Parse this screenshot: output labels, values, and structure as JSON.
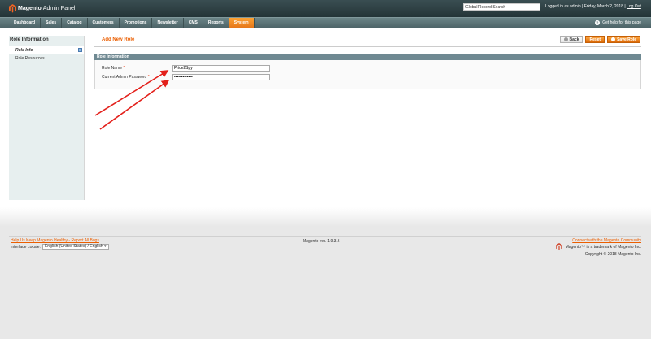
{
  "header": {
    "brand": "Magento",
    "brand_sub": "Admin Panel",
    "search_value": "Global Record Search",
    "info_text": "Logged in as admin  |  Friday, March 2, 2018  |",
    "logout_label": "Log Out"
  },
  "nav": {
    "items": [
      {
        "label": "Dashboard"
      },
      {
        "label": "Sales"
      },
      {
        "label": "Catalog"
      },
      {
        "label": "Customers"
      },
      {
        "label": "Promotions"
      },
      {
        "label": "Newsletter"
      },
      {
        "label": "CMS"
      },
      {
        "label": "Reports"
      },
      {
        "label": "System"
      }
    ],
    "active": "System",
    "help_label": "Get help for this page"
  },
  "side": {
    "title": "Role Information",
    "tabs": [
      {
        "label": "Role Info"
      },
      {
        "label": "Role Resources"
      }
    ]
  },
  "main": {
    "page_title": "Add New Role",
    "buttons": {
      "back": "Back",
      "reset": "Reset",
      "save": "Save Role"
    },
    "fieldset_title": "Role Information",
    "fields": {
      "role_name_label": "Role Name",
      "role_name_value": "Price2Spy",
      "password_label": "Current Admin Password",
      "password_value": "•••••••••••••"
    },
    "required_marker": "*"
  },
  "footer": {
    "bug_link": "Help Us Keep Magento Healthy - Report All Bugs",
    "locale_label": "Interface Locale:",
    "locale_value": "English (United States) / English",
    "version": "Magento ver. 1.9.3.6",
    "community_link": "Connect with the Magento Community",
    "trademark": "Magento™ is a trademark of Magento Inc.",
    "copyright": "Copyright © 2018 Magento Inc."
  },
  "colors": {
    "accent_orange": "#eb5e00",
    "nav_active": "#f18200",
    "header_bg": "#2b3d40",
    "arrow_red": "#e3201b"
  }
}
